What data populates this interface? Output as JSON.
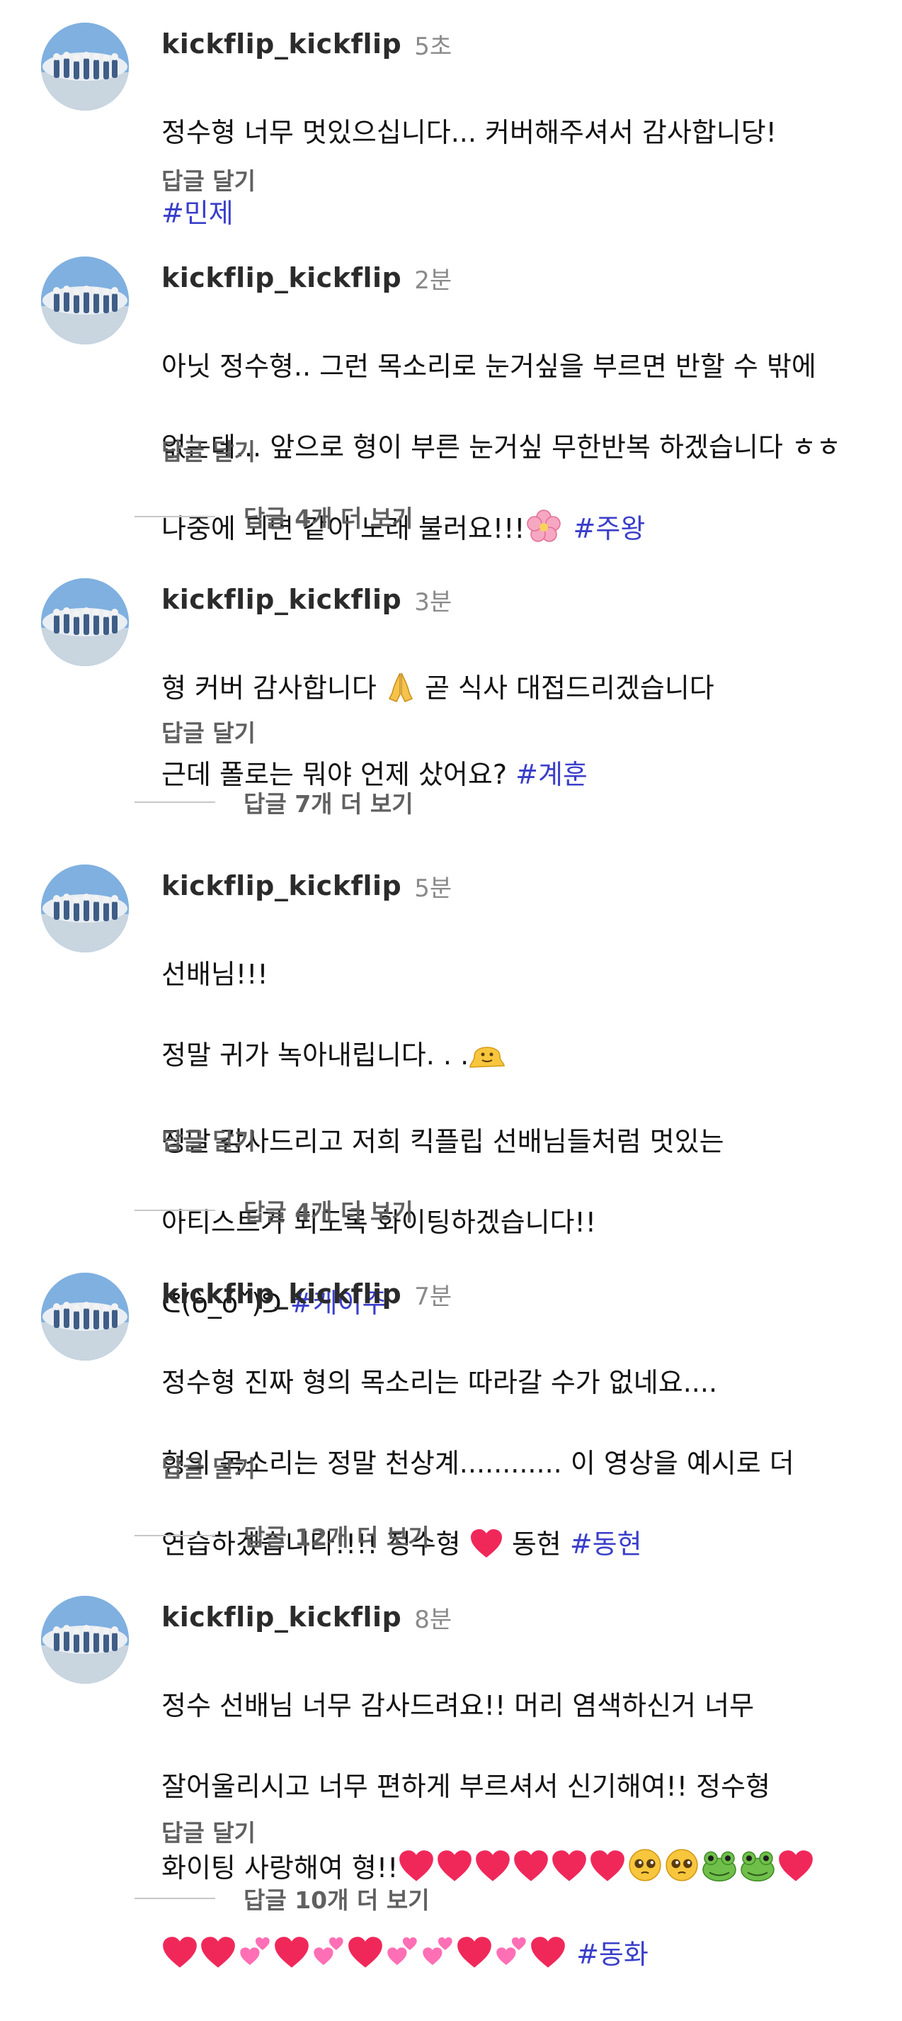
{
  "comments": [
    {
      "username": "kickflip_kickflip",
      "time": "5초",
      "lines": [
        "정수형 너무 멋있으십니다... 커버해주셔서 감사합니당!"
      ],
      "hashtag": "#민제",
      "reply_label": "답글 달기",
      "more_replies": null
    },
    {
      "username": "kickflip_kickflip",
      "time": "2분",
      "lines": [
        "아닛 정수형.. 그런 목소리로 눈거싶을 부르면 반할 수 밖에",
        "없는데... 앞으로 형이 부른 눈거싶 무한반복 하겠습니다 ㅎㅎ",
        "나중에 되면 같이 노래 불러요!!!"
      ],
      "emoji_after_last": [
        "cherry-blossom-emoji"
      ],
      "hashtag": "#주왕",
      "reply_label": "답글 달기",
      "more_replies": "답글 4개 더 보기"
    },
    {
      "username": "kickflip_kickflip",
      "time": "3분",
      "lines": [
        "형 커버 감사합니다",
        "근데 폴로는 뭐야 언제 샀어요?"
      ],
      "hashtag": "#계훈",
      "reply_label": "답글 달기",
      "more_replies": "답글 7개 더 보기"
    },
    {
      "username": "kickflip_kickflip",
      "time": "5분",
      "lines": [
        "선배님!!!",
        "정말 귀가 녹아내립니다. . .",
        "정말 감사드리고 저희 킥플립 선배님들처럼 멋있는",
        "아티스트가 되도록 화이팅하겠습니다!!",
        "ᕦ(ò_óˇ)ᕤ"
      ],
      "hashtag": "#케이주",
      "reply_label": "답글 달기",
      "more_replies": "답글 4개 더 보기"
    },
    {
      "username": "kickflip_kickflip",
      "time": "7분",
      "lines": [
        "정수형 진짜 형의 목소리는 따라갈 수가 없네요....",
        "형의 목소리는 정말 천상계............ 이 영상을 예시로 더",
        "연습하겠습니다!!!! 정수형",
        "동현"
      ],
      "hashtag": "#동현",
      "reply_label": "답글 달기",
      "more_replies": "답글 12개 더 보기"
    },
    {
      "username": "kickflip_kickflip",
      "time": "8분",
      "lines": [
        "정수 선배님 너무 감사드려요!! 머리 염색하신거 너무",
        "잘어울리시고 너무 편하게 부르셔서 신기해여!! 정수형",
        "화이팅 사랑해여 형!!"
      ],
      "hashtag": "#동화",
      "reply_label": "답글 달기",
      "more_replies": "답글 10개 더 보기"
    }
  ],
  "colors": {
    "hashtag": "#3a3fc9",
    "username": "#2b2b2b",
    "time": "#8a8a8a",
    "reply": "#606060",
    "heart": "#f0285a",
    "pink_heart": "#ff6fb5"
  }
}
